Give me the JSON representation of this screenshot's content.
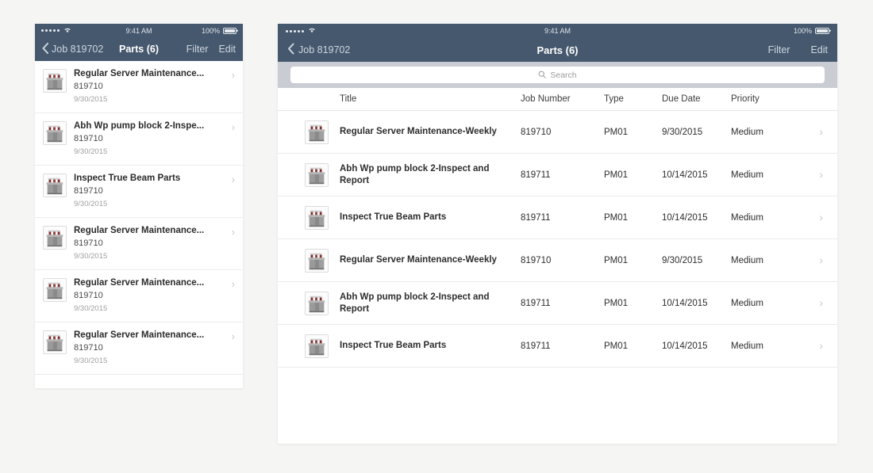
{
  "background_color": "#f5f5f4",
  "accent_color": "#46586e",
  "phone": {
    "status_bar": {
      "signal_dots": 5,
      "wifi_icon": "wifi-icon",
      "time": "9:41 AM",
      "battery_percent": "100%",
      "battery_icon": "battery-full-icon"
    },
    "nav": {
      "back_icon": "chevron-left-icon",
      "back_label": "Job 819702",
      "title": "Parts (6)",
      "filter_label": "Filter",
      "edit_label": "Edit"
    },
    "rows": [
      {
        "thumb": "equipment-thumbnail",
        "title": "Regular Server Maintenance...",
        "job_number": "819710",
        "due_date": "9/30/2015",
        "chevron": "chevron-right-icon"
      },
      {
        "thumb": "equipment-thumbnail",
        "title": "Abh Wp pump block 2-Inspe...",
        "job_number": "819710",
        "due_date": "9/30/2015",
        "chevron": "chevron-right-icon"
      },
      {
        "thumb": "equipment-thumbnail",
        "title": "Inspect True Beam Parts",
        "job_number": "819710",
        "due_date": "9/30/2015",
        "chevron": "chevron-right-icon"
      },
      {
        "thumb": "equipment-thumbnail",
        "title": "Regular Server Maintenance...",
        "job_number": "819710",
        "due_date": "9/30/2015",
        "chevron": "chevron-right-icon"
      },
      {
        "thumb": "equipment-thumbnail",
        "title": "Regular Server Maintenance...",
        "job_number": "819710",
        "due_date": "9/30/2015",
        "chevron": "chevron-right-icon"
      },
      {
        "thumb": "equipment-thumbnail",
        "title": "Regular Server Maintenance...",
        "job_number": "819710",
        "due_date": "9/30/2015",
        "chevron": "chevron-right-icon"
      }
    ]
  },
  "tablet": {
    "status_bar": {
      "signal_dots": 5,
      "wifi_icon": "wifi-icon",
      "time": "9:41 AM",
      "battery_percent": "100%",
      "battery_icon": "battery-full-icon"
    },
    "nav": {
      "back_icon": "chevron-left-icon",
      "back_label": "Job 819702",
      "title": "Parts (6)",
      "filter_label": "Filter",
      "edit_label": "Edit"
    },
    "search": {
      "icon": "search-icon",
      "placeholder": "Search",
      "value": ""
    },
    "table": {
      "columns": [
        "Title",
        "Job Number",
        "Type",
        "Due Date",
        "Priority"
      ],
      "rows": [
        {
          "thumb": "equipment-thumbnail",
          "title": "Regular Server Maintenance-Weekly",
          "job_number": "819710",
          "type": "PM01",
          "due_date": "9/30/2015",
          "priority": "Medium",
          "chevron": "chevron-right-icon"
        },
        {
          "thumb": "equipment-thumbnail",
          "title": "Abh Wp pump block 2-Inspect and Report",
          "job_number": "819711",
          "type": "PM01",
          "due_date": "10/14/2015",
          "priority": "Medium",
          "chevron": "chevron-right-icon"
        },
        {
          "thumb": "equipment-thumbnail",
          "title": "Inspect True Beam Parts",
          "job_number": "819711",
          "type": "PM01",
          "due_date": "10/14/2015",
          "priority": "Medium",
          "chevron": "chevron-right-icon"
        },
        {
          "thumb": "equipment-thumbnail",
          "title": "Regular Server Maintenance-Weekly",
          "job_number": "819710",
          "type": "PM01",
          "due_date": "9/30/2015",
          "priority": "Medium",
          "chevron": "chevron-right-icon"
        },
        {
          "thumb": "equipment-thumbnail",
          "title": "Abh Wp pump block 2-Inspect and Report",
          "job_number": "819711",
          "type": "PM01",
          "due_date": "10/14/2015",
          "priority": "Medium",
          "chevron": "chevron-right-icon"
        },
        {
          "thumb": "equipment-thumbnail",
          "title": "Inspect True Beam Parts",
          "job_number": "819711",
          "type": "PM01",
          "due_date": "10/14/2015",
          "priority": "Medium",
          "chevron": "chevron-right-icon"
        }
      ]
    }
  }
}
